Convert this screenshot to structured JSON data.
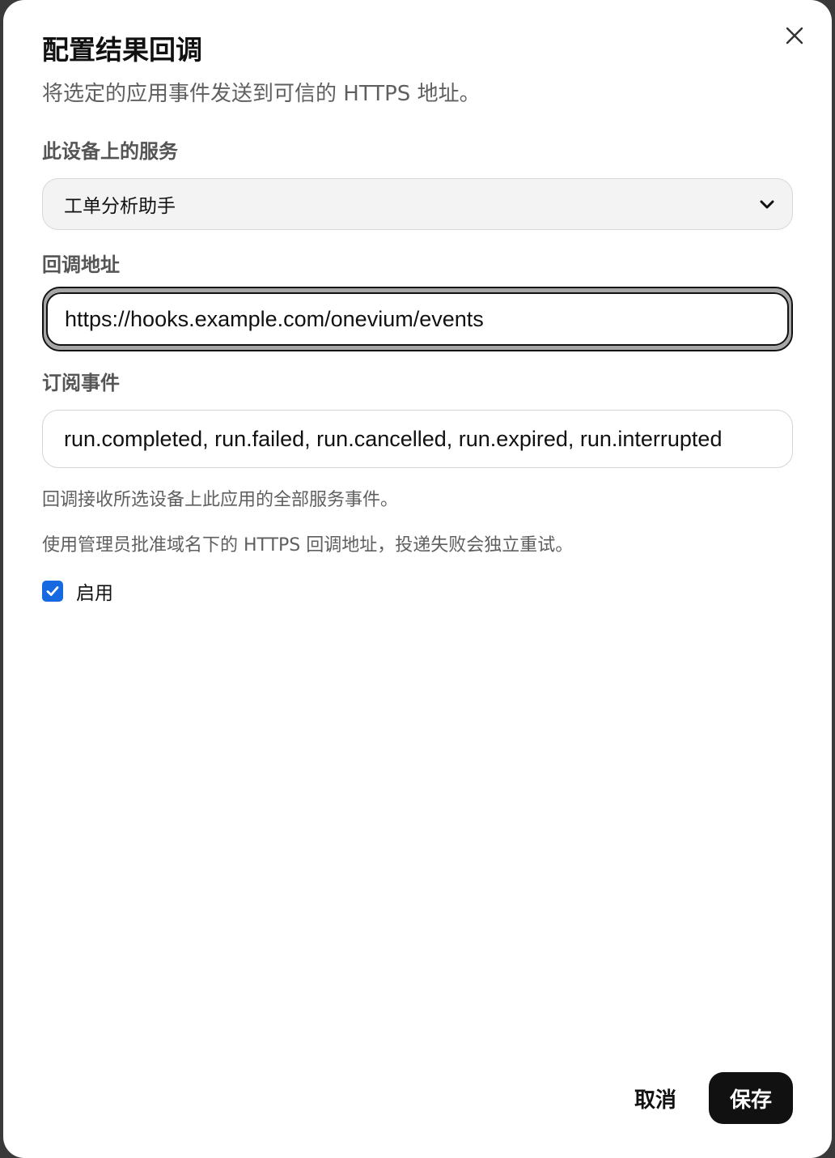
{
  "dialog": {
    "title": "配置结果回调",
    "subtitle": "将选定的应用事件发送到可信的 HTTPS 地址。",
    "close_icon": "close-icon"
  },
  "service": {
    "label": "此设备上的服务",
    "selected": "工单分析助手"
  },
  "callback_url": {
    "label": "回调地址",
    "value": "https://hooks.example.com/onevium/events"
  },
  "events": {
    "label": "订阅事件",
    "value": "run.completed, run.failed, run.cancelled, run.expired, run.interrupted"
  },
  "hints": {
    "line1": "回调接收所选设备上此应用的全部服务事件。",
    "line2": "使用管理员批准域名下的 HTTPS 回调地址，投递失败会独立重试。"
  },
  "enabled": {
    "label": "启用",
    "checked": true
  },
  "footer": {
    "cancel_label": "取消",
    "save_label": "保存"
  },
  "colors": {
    "accent": "#1669e0",
    "primary_button": "#111111"
  }
}
